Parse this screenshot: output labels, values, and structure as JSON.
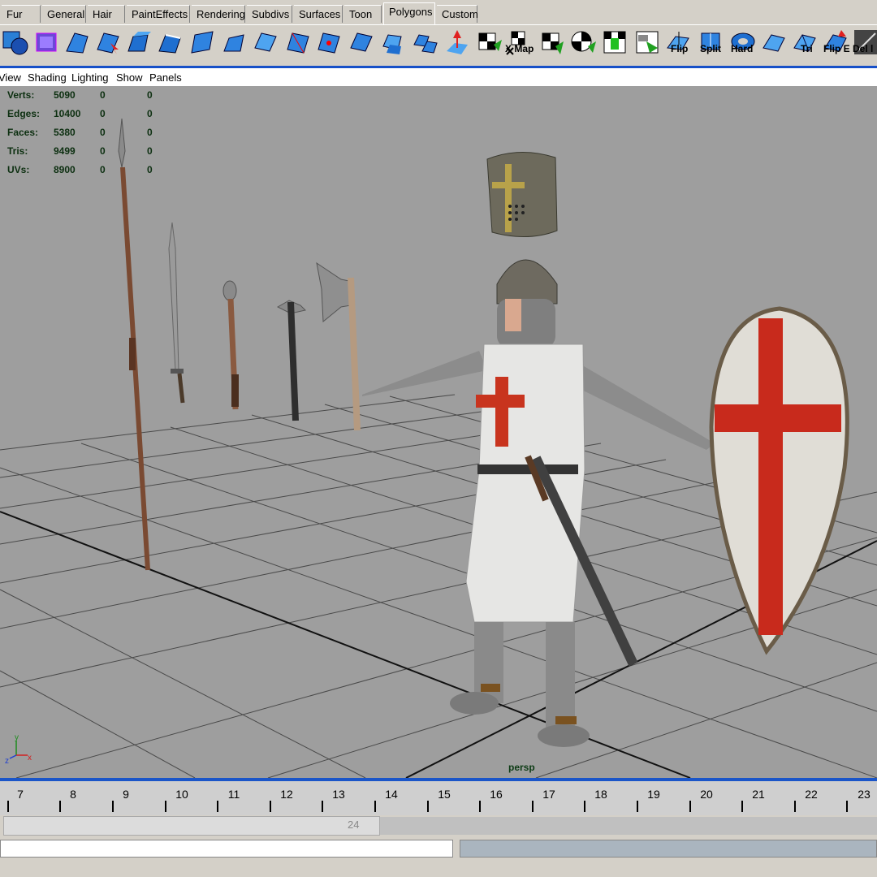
{
  "shelf": {
    "tabs": [
      "Fur",
      "General",
      "Hair",
      "PaintEffects",
      "Rendering",
      "Subdivs",
      "Surfaces",
      "Toon",
      "Polygons",
      "Custom"
    ],
    "active_tab": "Polygons",
    "icon_labels": [
      "X Map",
      "Flip",
      "Split",
      "Hard",
      "Tri",
      "Flip E",
      "Del l"
    ]
  },
  "panel_menu": [
    "View",
    "Shading",
    "Lighting",
    "Show",
    "Panels"
  ],
  "hud": {
    "rows": [
      {
        "label": "Verts:",
        "total": "5090",
        "selected": "0",
        "other": "0"
      },
      {
        "label": "Edges:",
        "total": "10400",
        "selected": "0",
        "other": "0"
      },
      {
        "label": "Faces:",
        "total": "5380",
        "selected": "0",
        "other": "0"
      },
      {
        "label": "Tris:",
        "total": "9499",
        "selected": "0",
        "other": "0"
      },
      {
        "label": "UVs:",
        "total": "8900",
        "selected": "0",
        "other": "0"
      }
    ]
  },
  "viewport": {
    "camera_label": "persp",
    "axis": {
      "y": "y",
      "z": "z",
      "x": "x"
    }
  },
  "timeline": {
    "frames": [
      "7",
      "8",
      "9",
      "10",
      "11",
      "12",
      "13",
      "14",
      "15",
      "16",
      "17",
      "18",
      "19",
      "20",
      "21",
      "22",
      "23"
    ]
  },
  "range": {
    "end_frame": "24"
  },
  "colors": {
    "viewport_bg": "#9e9e9e",
    "accent_blue": "#1a55c8",
    "hud_text": "#0c2f10",
    "templar_red": "#c82a1c"
  }
}
